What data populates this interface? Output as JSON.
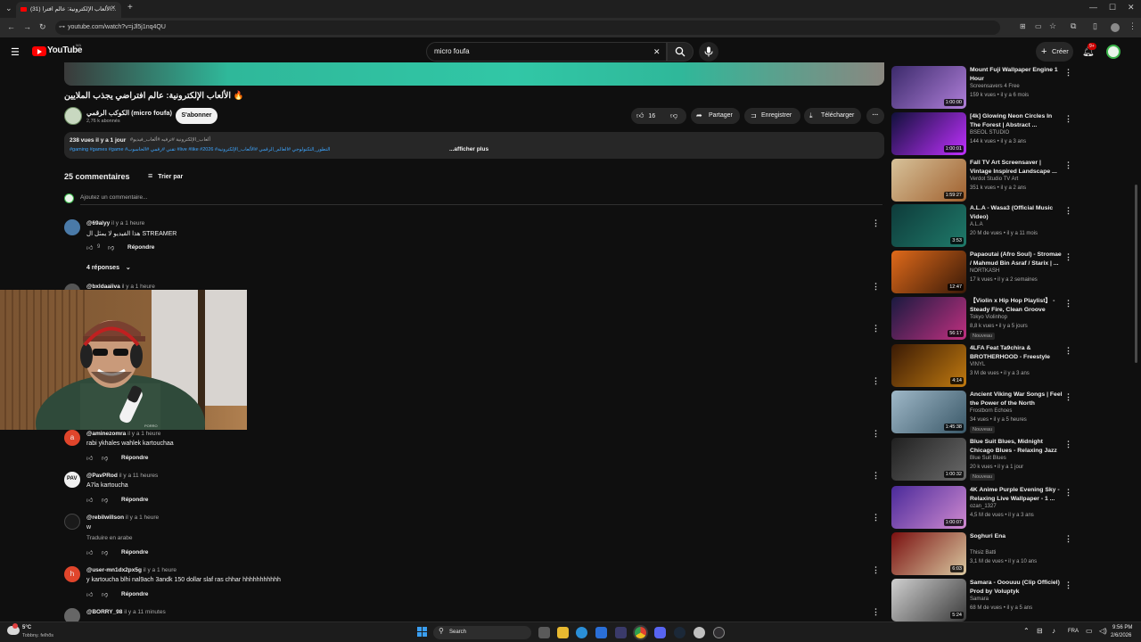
{
  "browser": {
    "tab_title": "(31) الألعاب الإلكترونية: عالم افترا...",
    "url": "youtube.com/watch?v=jJl5j1nq4QU"
  },
  "header": {
    "logo_text": "YouTube",
    "logo_sup": "MA",
    "search_value": "micro foufa",
    "create_label": "Créer",
    "notif_badge": "9+"
  },
  "video": {
    "title": "الألعاب الإلكترونية: عالم افتراضي يجذب الملايين 🔥",
    "channel_name": "الكوكب الرقمي (micro foufa)",
    "subscribers": "2,76 k abonnés",
    "subscribe_label": "S'abonner",
    "likes": "16",
    "share_label": "Partager",
    "save_label": "Enregistrer",
    "download_label": "Télécharger"
  },
  "description": {
    "stats": "238 vues  il y a 1 jour",
    "hashtags_line1": "#ألعاب_الإلكترونية #ترفيه #ألعاب_فيديو",
    "hashtags_line2": "#gaming #games #game #تقني #رقمي #الحاسوب #live #like #2026 #التطور_التكنولوجي #العالم_الرقمي #الألعاب_الإلكترونية",
    "more_label": "...afficher plus"
  },
  "comments": {
    "count_label": "25 commentaires",
    "sort_label": "Trier par",
    "add_placeholder": "Ajoutez un commentaire...",
    "reply_label": "Répondre",
    "replies_label": "4 réponses",
    "items": [
      {
        "user": "@69alyy",
        "time": "il y a 1 heure",
        "text": "هذا الفيديو لا يمثل ال STREAMER",
        "likes": "9"
      },
      {
        "user": "@bxldaaiiva",
        "time": "il y a 1 heure",
        "text": ""
      },
      {
        "user": "@aminezomra",
        "time": "il y a 1 heure",
        "text": "rabi ykhales wahlek kartouchaa"
      },
      {
        "user": "@PavPRod",
        "time": "il y a 11 heures",
        "text": "A7la kartoucha"
      },
      {
        "user": "@rebilwillson",
        "time": "il y a 1 heure",
        "text": "w",
        "translate": "Traduire en arabe"
      },
      {
        "user": "@user-mn1dx2px5g",
        "time": "il y a 1 heure",
        "text": "y kartoucha blhi nal9ach 3andk 150 dollar slaf ras chhar hhhhhhhhhhh"
      },
      {
        "user": "@BORRY_98",
        "time": "il y a 11 minutes",
        "text": ""
      }
    ]
  },
  "recommendations": [
    {
      "title": "Mount Fuji Wallpaper Engine 1 Hour",
      "channel": "Screensavers 4 Free",
      "meta": "159 k vues • il y a 6 mois",
      "duration": "1:00:00",
      "badge": "",
      "colors": [
        "#3b2a6b",
        "#b07fd9"
      ]
    },
    {
      "title": "[4k] Glowing Neon Circles In The Forest | Abstract ...",
      "channel": "BSEOL STUDIO",
      "meta": "144 k vues • il y a 3 ans",
      "duration": "1:00:01",
      "badge": "",
      "colors": [
        "#10103a",
        "#c030ff"
      ]
    },
    {
      "title": "Fall TV Art Screensaver | Vintage Inspired Landscape ...",
      "channel": "Verdot Studio TV Art",
      "meta": "351 k vues • il y a 2 ans",
      "duration": "1:59:27",
      "badge": "",
      "colors": [
        "#d7c29a",
        "#a0602e"
      ]
    },
    {
      "title": "A.L.A - Wasa3 (Official Music Video)",
      "channel": "A.L.A",
      "meta": "20 M de vues • il y a 11 mois",
      "duration": "3:53",
      "badge": "",
      "colors": [
        "#0e3b3a",
        "#1f7a6a"
      ]
    },
    {
      "title": "Papaoutai (Afro Soul) - Stromae / Mahmud Bin Asraf / Starix | ...",
      "channel": "NORTKASH",
      "meta": "17 k vues • il y a 2 semaines",
      "duration": "12:47",
      "badge": "",
      "colors": [
        "#e06a1a",
        "#3a1a08"
      ]
    },
    {
      "title": "【Violin x Hip Hop Playlist】 - Steady Fire, Clean Groove",
      "channel": "Tokyo Violinhop",
      "meta": "8,8 k vues • il y a 5 jours",
      "duration": "56:17",
      "badge": "Nouveau",
      "colors": [
        "#1a1a40",
        "#c03080"
      ]
    },
    {
      "title": "4LFA Feat Ta9chira & BROTHERHOOD - Freestyle",
      "channel": "VINYL",
      "meta": "3 M de vues • il y a 3 ans",
      "duration": "4:14",
      "badge": "",
      "colors": [
        "#3a1a05",
        "#c07a10"
      ]
    },
    {
      "title": "Ancient Viking War Songs | Feel the Power of the North",
      "channel": "Frostborn Echoes",
      "meta": "34 vues • il y a 5 heures",
      "duration": "1:45:38",
      "badge": "Nouveau",
      "colors": [
        "#9fb8c8",
        "#3a5868"
      ]
    },
    {
      "title": "Blue Suit Blues, Midnight Chicago Blues - Relaxing Jazz ...",
      "channel": "Blue Suit Blues",
      "meta": "20 k vues • il y a 1 jour",
      "duration": "1:00:32",
      "badge": "Nouveau",
      "colors": [
        "#202020",
        "#6a6a6a"
      ]
    },
    {
      "title": "4K Anime Purple Evening Sky - Relaxing Live Wallpaper - 1 ...",
      "channel": "ozan_1327",
      "meta": "4,5 M de vues • il y a 3 ans",
      "duration": "1:00:07",
      "badge": "",
      "colors": [
        "#4a2a9a",
        "#d08ad0"
      ]
    },
    {
      "title": "Soghuri Ena",
      "channel": "Thisiz Batti",
      "meta": "3,1 M de vues • il y a 10 ans",
      "duration": "6:03",
      "badge": "",
      "colors": [
        "#7a1010",
        "#d9c8a0"
      ]
    },
    {
      "title": "Samara - Ooouuu (Clip Officiel) Prod by Voluptyk",
      "channel": "Samara",
      "meta": "68 M de vues • il y a 5 ans",
      "duration": "5:24",
      "badge": "",
      "colors": [
        "#d0d0d0",
        "#3a3a3a"
      ]
    }
  ],
  "taskbar": {
    "weather_temp": "5°C",
    "weather_desc": "Tobbny. felhős",
    "search_label": "Search",
    "lang": "FRA",
    "time": "9:56 PM",
    "date": "2/6/2026"
  },
  "webcam": {
    "watermark": "PORRO"
  }
}
